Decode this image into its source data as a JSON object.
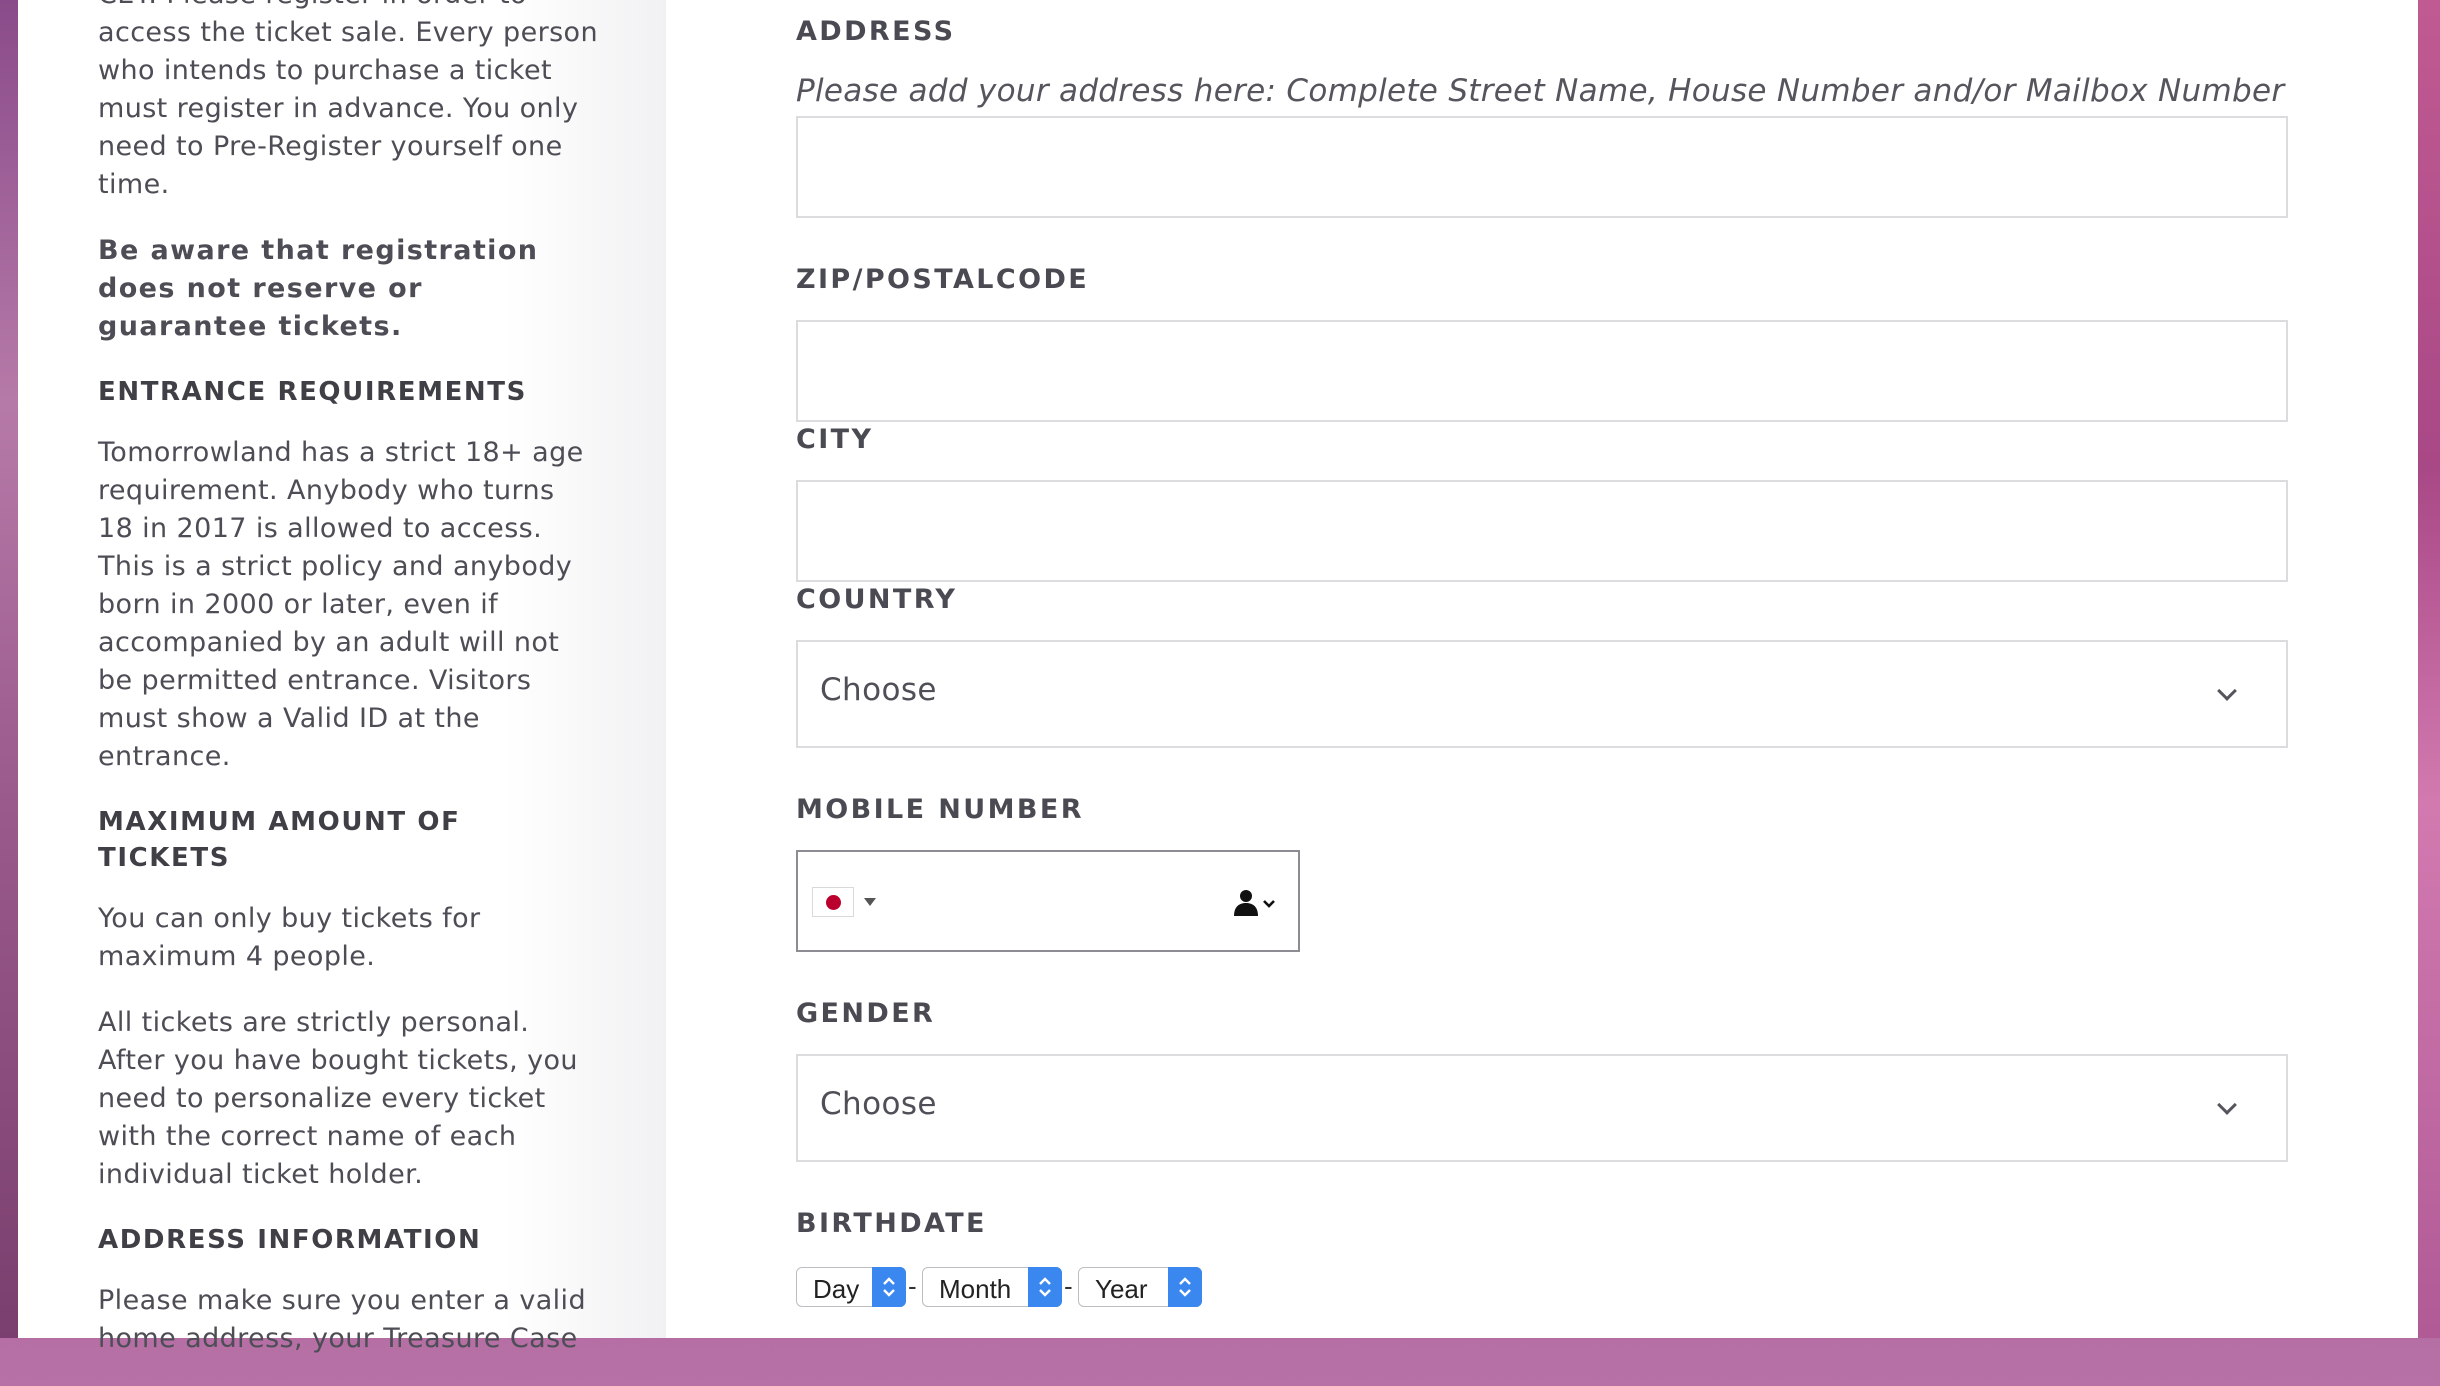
{
  "sidebar": {
    "intro_paragraph": "CET. Please register in order to access the ticket sale. Every person who intends to purchase a ticket must register in advance. You only need to Pre-Register yourself one time.",
    "warning": "Be aware that registration does not reserve or guarantee tickets.",
    "sections": [
      {
        "heading": "ENTRANCE REQUIREMENTS",
        "paragraphs": [
          "Tomorrowland has a strict 18+ age requirement. Anybody who turns 18 in 2017 is allowed to access. This is a strict policy and anybody born in 2000 or later, even if accompanied by an adult will not be permitted entrance. Visitors must show a Valid ID at the entrance."
        ]
      },
      {
        "heading": "MAXIMUM AMOUNT OF TICKETS",
        "paragraphs": [
          "You can only buy tickets for maximum 4 people.",
          "All tickets are strictly personal. After you have bought tickets, you need to personalize every ticket with the correct name of each individual ticket holder."
        ]
      },
      {
        "heading": "ADDRESS INFORMATION",
        "paragraphs": [
          "Please make sure you enter a valid home address, your Treasure Case"
        ]
      }
    ]
  },
  "form": {
    "address": {
      "label": "ADDRESS",
      "hint": "Please add your address here: Complete Street Name, House Number and/or Mailbox Number",
      "value": ""
    },
    "zip": {
      "label": "ZIP/POSTALCODE",
      "value": ""
    },
    "city": {
      "label": "CITY",
      "value": ""
    },
    "country": {
      "label": "COUNTRY",
      "selected": "Choose"
    },
    "mobile": {
      "label": "MOBILE NUMBER",
      "country_flag": "japan-flag",
      "value": ""
    },
    "gender": {
      "label": "GENDER",
      "selected": "Choose"
    },
    "birthdate": {
      "label": "BIRTHDATE",
      "day": "Day",
      "month": "Month",
      "year": "Year",
      "separator": "-"
    }
  }
}
